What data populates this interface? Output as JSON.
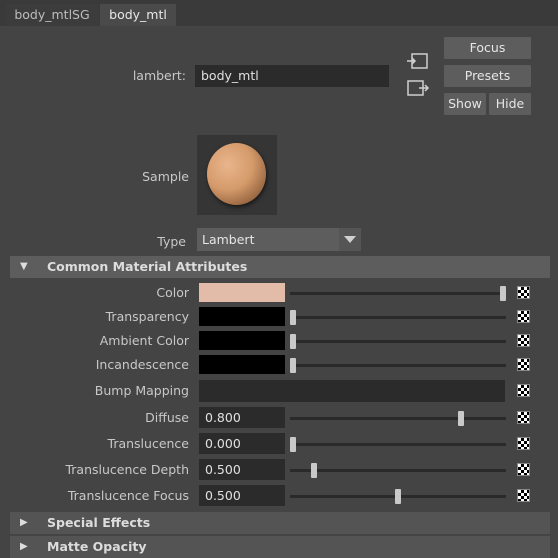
{
  "tabs": [
    {
      "label": "body_mtlSG",
      "active": false
    },
    {
      "label": "body_mtl",
      "active": true
    }
  ],
  "header": {
    "type_label": "lambert:",
    "name_value": "body_mtl",
    "buttons": {
      "focus": "Focus",
      "presets": "Presets",
      "show": "Show",
      "hide": "Hide"
    },
    "icons": [
      "input-connection-icon",
      "output-connection-icon"
    ]
  },
  "sample": {
    "label": "Sample",
    "sphere_color": "#d49a6a"
  },
  "type_row": {
    "label": "Type",
    "value": "Lambert"
  },
  "sections": {
    "common": "Common Material Attributes",
    "special": "Special Effects",
    "matte": "Matte Opacity"
  },
  "attributes": {
    "color": {
      "label": "Color",
      "swatch": "#e2bca8",
      "level": 1.0
    },
    "transparency": {
      "label": "Transparency",
      "swatch": "#000000",
      "level": 0.0
    },
    "ambient": {
      "label": "Ambient Color",
      "swatch": "#000000",
      "level": 0.0
    },
    "incandescence": {
      "label": "Incandescence",
      "swatch": "#000000",
      "level": 0.0
    },
    "bump": {
      "label": "Bump Mapping"
    },
    "diffuse": {
      "label": "Diffuse",
      "value": "0.800",
      "level": 0.8
    },
    "translucence": {
      "label": "Translucence",
      "value": "0.000",
      "level": 0.0
    },
    "translucence_depth": {
      "label": "Translucence Depth",
      "value": "0.500",
      "level": 0.1
    },
    "translucence_focus": {
      "label": "Translucence Focus",
      "value": "0.500",
      "level": 0.5
    }
  }
}
